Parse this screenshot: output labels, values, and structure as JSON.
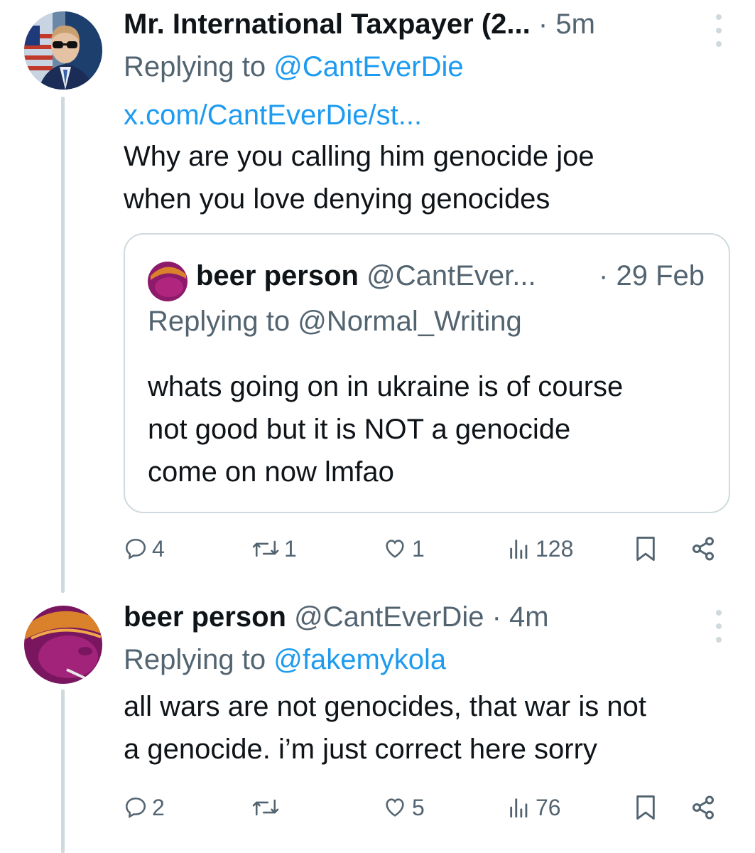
{
  "colors": {
    "link": "#1d9bf0",
    "secondary": "#536471",
    "border": "#cfd9de",
    "text": "#0f1419"
  },
  "tweets": [
    {
      "author": "Mr. International Taxpayer (2...",
      "time": "· 5m",
      "reply_prefix": "Replying to ",
      "reply_to": "@CantEverDie",
      "link": "x.com/CantEverDie/st...",
      "text_lines": [
        "Why are you calling him genocide joe",
        "when you love denying genocides"
      ],
      "quote": {
        "author": "beer person",
        "handle": "@CantEver...",
        "time": "· 29 Feb",
        "reply_prefix": "Replying to ",
        "reply_to": "@Normal_Writing",
        "text_lines": [
          "whats going on in ukraine is of course",
          "not good but it is NOT a genocide",
          "come on now lmfao"
        ]
      },
      "actions": {
        "replies": "4",
        "reposts": "1",
        "likes": "1",
        "views": "128"
      },
      "icons": [
        "reply-icon",
        "repost-icon",
        "like-icon",
        "views-icon",
        "bookmark-icon",
        "share-icon"
      ]
    },
    {
      "author": "beer person",
      "handle": "@CantEverDie",
      "time": "· 4m",
      "reply_prefix": "Replying to ",
      "reply_to": "@fakemykola",
      "text_lines": [
        "all wars are not genocides, that war is not",
        "a genocide.  i’m just correct here sorry"
      ],
      "actions": {
        "replies": "2",
        "reposts": "",
        "likes": "5",
        "views": "76"
      },
      "icons": [
        "reply-icon",
        "repost-icon",
        "like-icon",
        "views-icon",
        "bookmark-icon",
        "share-icon"
      ]
    }
  ]
}
